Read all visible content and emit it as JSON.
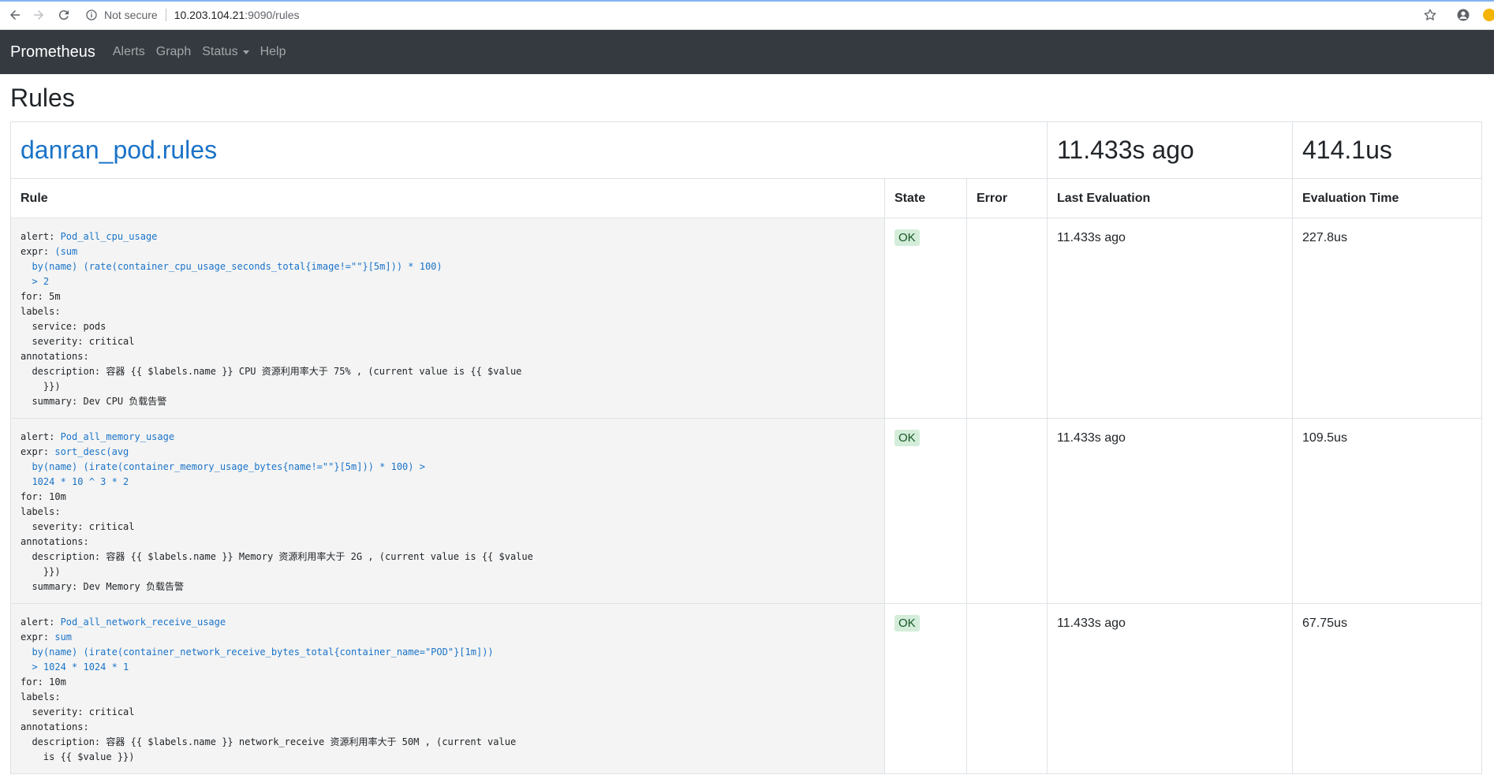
{
  "browser": {
    "security_label": "Not secure",
    "url_host": "10.203.104.21",
    "url_path": ":9090/rules"
  },
  "navbar": {
    "brand": "Prometheus",
    "links": [
      {
        "label": "Alerts"
      },
      {
        "label": "Graph"
      },
      {
        "label": "Status"
      },
      {
        "label": "Help"
      }
    ]
  },
  "page": {
    "title": "Rules"
  },
  "group": {
    "name": "danran_pod.rules",
    "last_evaluation": "11.433s ago",
    "evaluation_time": "414.1us"
  },
  "table_headers": {
    "rule": "Rule",
    "state": "State",
    "error": "Error",
    "last_evaluation": "Last Evaluation",
    "evaluation_time": "Evaluation Time"
  },
  "rules": [
    {
      "alert_key": "alert: ",
      "alert_name": "Pod_all_cpu_usage",
      "expr_key": "expr: ",
      "expr_lines": [
        "(sum",
        "  by(name) (rate(container_cpu_usage_seconds_total{image!=\"\"}[5m])) * 100)",
        "  > 2"
      ],
      "body": "for: 5m\nlabels:\n  service: pods\n  severity: critical\nannotations:\n  description: 容器 {{ $labels.name }} CPU 资源利用率大于 75% , (current value is {{ $value\n    }})\n  summary: Dev CPU 负载告警",
      "state": "OK",
      "error": "",
      "last_evaluation": "11.433s ago",
      "evaluation_time": "227.8us"
    },
    {
      "alert_key": "alert: ",
      "alert_name": "Pod_all_memory_usage",
      "expr_key": "expr: ",
      "expr_lines": [
        "sort_desc(avg",
        "  by(name) (irate(container_memory_usage_bytes{name!=\"\"}[5m])) * 100) >",
        "  1024 * 10 ^ 3 * 2"
      ],
      "body": "for: 10m\nlabels:\n  severity: critical\nannotations:\n  description: 容器 {{ $labels.name }} Memory 资源利用率大于 2G , (current value is {{ $value\n    }})\n  summary: Dev Memory 负载告警",
      "state": "OK",
      "error": "",
      "last_evaluation": "11.433s ago",
      "evaluation_time": "109.5us"
    },
    {
      "alert_key": "alert: ",
      "alert_name": "Pod_all_network_receive_usage",
      "expr_key": "expr: ",
      "expr_lines": [
        "sum",
        "  by(name) (irate(container_network_receive_bytes_total{container_name=\"POD\"}[1m]))",
        "  > 1024 * 1024 * 1"
      ],
      "body": "for: 10m\nlabels:\n  severity: critical\nannotations:\n  description: 容器 {{ $labels.name }} network_receive 资源利用率大于 50M , (current value\n    is {{ $value }})",
      "state": "OK",
      "error": "",
      "last_evaluation": "11.433s ago",
      "evaluation_time": "67.75us"
    }
  ]
}
